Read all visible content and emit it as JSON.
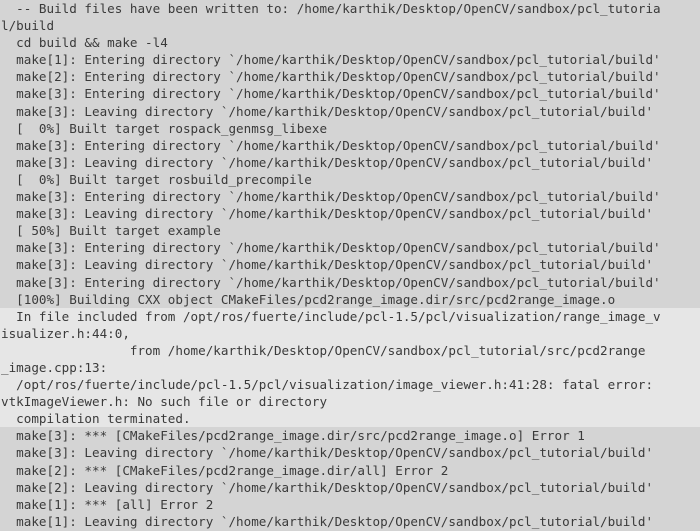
{
  "terminal": {
    "colors": {
      "background": "#d4d4d4",
      "highlight": "#e6e6e6",
      "text": "#3a3a3a"
    },
    "lines": [
      {
        "text": "  -- Build files have been written to: /home/karthik/Desktop/OpenCV/sandbox/pcl_tutoria",
        "hl": false
      },
      {
        "text": "l/build",
        "hl": false
      },
      {
        "text": "  cd build && make -l4",
        "hl": false
      },
      {
        "text": "  make[1]: Entering directory `/home/karthik/Desktop/OpenCV/sandbox/pcl_tutorial/build'",
        "hl": false
      },
      {
        "text": "  make[2]: Entering directory `/home/karthik/Desktop/OpenCV/sandbox/pcl_tutorial/build'",
        "hl": false
      },
      {
        "text": "  make[3]: Entering directory `/home/karthik/Desktop/OpenCV/sandbox/pcl_tutorial/build'",
        "hl": false
      },
      {
        "text": "  make[3]: Leaving directory `/home/karthik/Desktop/OpenCV/sandbox/pcl_tutorial/build'",
        "hl": false
      },
      {
        "text": "  [  0%] Built target rospack_genmsg_libexe",
        "hl": false
      },
      {
        "text": "  make[3]: Entering directory `/home/karthik/Desktop/OpenCV/sandbox/pcl_tutorial/build'",
        "hl": false
      },
      {
        "text": "  make[3]: Leaving directory `/home/karthik/Desktop/OpenCV/sandbox/pcl_tutorial/build'",
        "hl": false
      },
      {
        "text": "  [  0%] Built target rosbuild_precompile",
        "hl": false
      },
      {
        "text": "  make[3]: Entering directory `/home/karthik/Desktop/OpenCV/sandbox/pcl_tutorial/build'",
        "hl": false
      },
      {
        "text": "  make[3]: Leaving directory `/home/karthik/Desktop/OpenCV/sandbox/pcl_tutorial/build'",
        "hl": false
      },
      {
        "text": "  [ 50%] Built target example",
        "hl": false
      },
      {
        "text": "  make[3]: Entering directory `/home/karthik/Desktop/OpenCV/sandbox/pcl_tutorial/build'",
        "hl": false
      },
      {
        "text": "  make[3]: Leaving directory `/home/karthik/Desktop/OpenCV/sandbox/pcl_tutorial/build'",
        "hl": false
      },
      {
        "text": "  make[3]: Entering directory `/home/karthik/Desktop/OpenCV/sandbox/pcl_tutorial/build'",
        "hl": false
      },
      {
        "text": "  [100%] Building CXX object CMakeFiles/pcd2range_image.dir/src/pcd2range_image.o",
        "hl": false
      },
      {
        "text": "  In file included from /opt/ros/fuerte/include/pcl-1.5/pcl/visualization/range_image_v",
        "hl": true
      },
      {
        "text": "isualizer.h:44:0,",
        "hl": true
      },
      {
        "text": "                 from /home/karthik/Desktop/OpenCV/sandbox/pcl_tutorial/src/pcd2range",
        "hl": true
      },
      {
        "text": "_image.cpp:13:",
        "hl": true
      },
      {
        "text": "  /opt/ros/fuerte/include/pcl-1.5/pcl/visualization/image_viewer.h:41:28: fatal error:",
        "hl": true
      },
      {
        "text": "vtkImageViewer.h: No such file or directory",
        "hl": true
      },
      {
        "text": "  compilation terminated.",
        "hl": true
      },
      {
        "text": "  make[3]: *** [CMakeFiles/pcd2range_image.dir/src/pcd2range_image.o] Error 1",
        "hl": false
      },
      {
        "text": "  make[3]: Leaving directory `/home/karthik/Desktop/OpenCV/sandbox/pcl_tutorial/build'",
        "hl": false
      },
      {
        "text": "  make[2]: *** [CMakeFiles/pcd2range_image.dir/all] Error 2",
        "hl": false
      },
      {
        "text": "  make[2]: Leaving directory `/home/karthik/Desktop/OpenCV/sandbox/pcl_tutorial/build'",
        "hl": false
      },
      {
        "text": "  make[1]: *** [all] Error 2",
        "hl": false
      },
      {
        "text": "  make[1]: Leaving directory `/home/karthik/Desktop/OpenCV/sandbox/pcl_tutorial/build'",
        "hl": false
      }
    ]
  }
}
